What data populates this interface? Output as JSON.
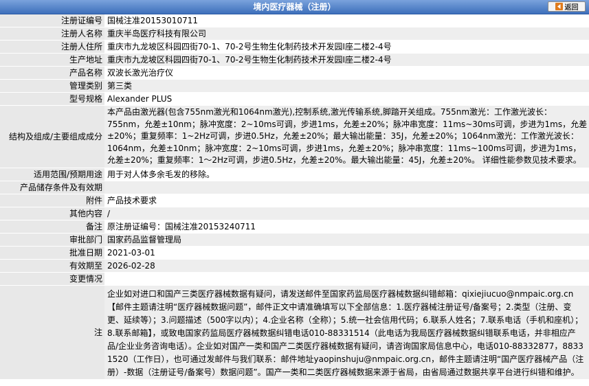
{
  "header": {
    "title": "境内医疗器械（注册）",
    "back_label": "返回"
  },
  "rows": [
    {
      "label": "注册证编号",
      "value": "国械注准20153010711"
    },
    {
      "label": "注册人名称",
      "value": "重庆半岛医疗科技有限公司"
    },
    {
      "label": "注册人住所",
      "value": "重庆市九龙坡区科园四街70-1、70-2号生物生化制药技术开发园I座二楼2-4号"
    },
    {
      "label": "生产地址",
      "value": "重庆市九龙坡区科园四街70-1、70-2号生物生化制药技术开发园I座二楼2-4号"
    },
    {
      "label": "产品名称",
      "value": "双波长激光治疗仪"
    },
    {
      "label": "管理类别",
      "value": "第三类"
    },
    {
      "label": "型号规格",
      "value": "Alexander PLUS"
    },
    {
      "label": "结构及组成/主要组成成分",
      "value": "本产品由激光器(包含755nm激光和1064nm激光),控制系统,激光传输系统,脚踏开关组成。755nm激光：工作激光波长：755nm，允差±10nm；脉冲宽度：2~10ms可调，步进1ms，允差±20%；脉冲串宽度：11ms~30ms可调，步进为1ms，允差±20%；重复频率：1~2Hz可调，步进0.5Hz，允差±20%；最大输出能量：35J，允差±20%；1064nm激光：工作激光波长：1064nm，允差±10nm；脉冲宽度：2~10ms可调，步进1ms，允差±20%；脉冲串宽度：11ms~100ms可调，步进为1ms，允差±20%；重复频率：1～2Hz可调，步进0.5Hz，允差±20%。最大输出能量：45J，允差±20%。 详细性能参数见技术要求。"
    },
    {
      "label": "适用范围/预期用途",
      "value": "用于对人体多余毛发的移除。"
    },
    {
      "label": "产品储存条件及有效期",
      "value": ""
    },
    {
      "label": "附件",
      "value": "产品技术要求"
    },
    {
      "label": "其他内容",
      "value": "/"
    },
    {
      "label": "备注",
      "value": "原注册证编号：国械注准20153240711"
    },
    {
      "label": "审批部门",
      "value": "国家药品监督管理局"
    },
    {
      "label": "批准日期",
      "value": "2021-03-01"
    },
    {
      "label": "有效期至",
      "value": "2026-02-28"
    },
    {
      "label": "变更情况",
      "value": ""
    }
  ],
  "note": {
    "label": "注",
    "text": "企业如对进口和国产三类医疗器械数据有疑问，请发送邮件至国家药监局医疗器械数据纠错邮箱：qixiejiucuo@nmpaic.org.cn【邮件主题请注明“医疗器械数据问题”，邮件正文中请准确填写以下全部信息：1.医疗器械注册证号/备案号；2.类型（注册、变更、延续等）；3.问题描述（500字以内）；4.企业名称（全称）；5.统一社会信用代码；6.联系人姓名；7.联系电话（手机和座机）；8.联系邮箱】，或致电国家药监局医疗器械数据纠错电话010-88331514（此电话为我局医疗器械数据纠错联系电话，并非相应产品/企业业务咨询电话）。企业如对国产一类和国产二类医疗器械数据有疑问，请咨询国家局信息中心，电话010-88332877，88331520（工作日），也可通过发邮件与我们联系：邮件地址yaopinshuju@nmpaic.org.cn，邮件主题请注明“国产医疗器械产品（注册）-数据（注册证号/备案号）数据问题”。国产一类和二类医疗器械数据来源于省局，由省局通过数据共享平台进行纠错和维护。"
  },
  "colors": {
    "header_top": "#7aa2dc",
    "header_bottom": "#3d6fbb",
    "label_bg": "#e8e8e8",
    "alt_row_bg": "#eeeeee"
  }
}
